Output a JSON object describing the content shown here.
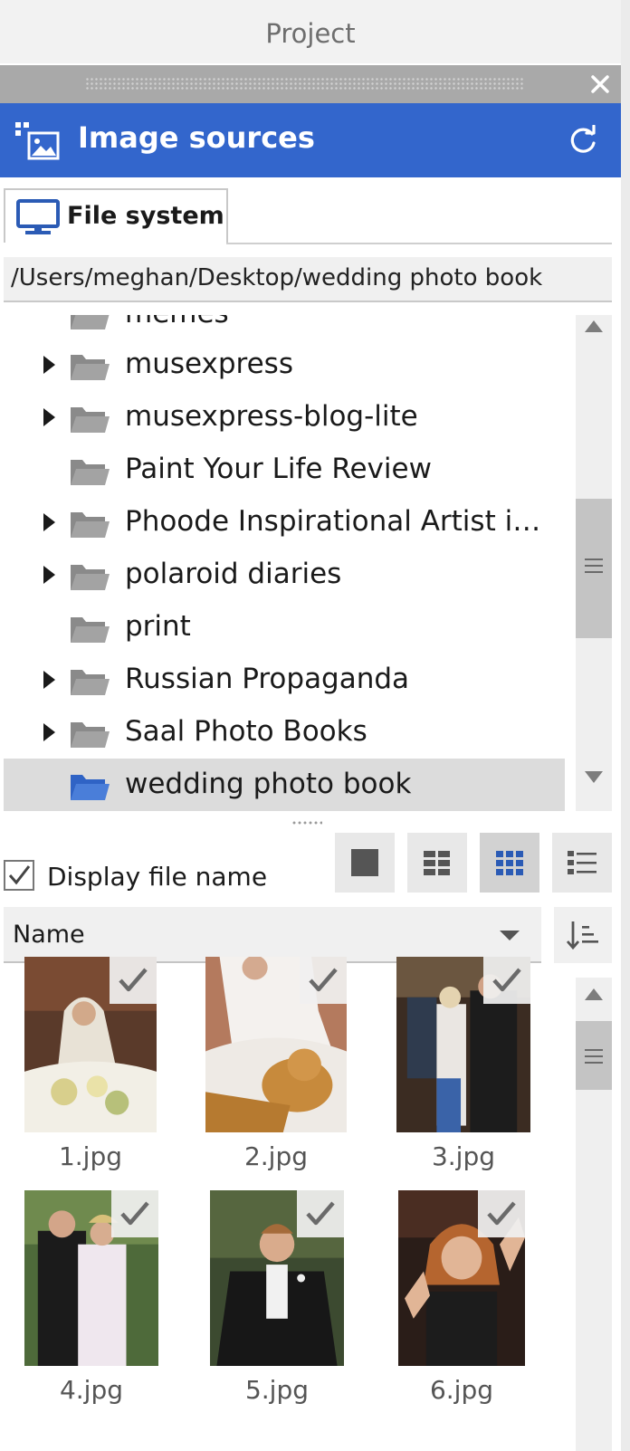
{
  "window": {
    "title": "Project"
  },
  "panel": {
    "title": "Image sources",
    "close_icon": "close-icon",
    "refresh_icon": "refresh-icon",
    "header_color": "#3366cc"
  },
  "tabs": [
    {
      "label": "File system",
      "icon": "monitor-icon",
      "active": true
    }
  ],
  "path": "/Users/meghan/Desktop/wedding photo book",
  "tree": {
    "items": [
      {
        "label": "memes",
        "expandable": false,
        "selected": false
      },
      {
        "label": "musexpress",
        "expandable": true,
        "selected": false
      },
      {
        "label": "musexpress-blog-lite",
        "expandable": true,
        "selected": false
      },
      {
        "label": "Paint Your Life Review",
        "expandable": false,
        "selected": false
      },
      {
        "label": "Phoode Inspirational Artist i…",
        "expandable": true,
        "selected": false
      },
      {
        "label": "polaroid diaries",
        "expandable": true,
        "selected": false
      },
      {
        "label": "print",
        "expandable": false,
        "selected": false
      },
      {
        "label": "Russian Propaganda",
        "expandable": true,
        "selected": false
      },
      {
        "label": "Saal Photo Books",
        "expandable": true,
        "selected": false
      },
      {
        "label": "wedding photo book",
        "expandable": false,
        "selected": true
      }
    ]
  },
  "view_options": {
    "display_file_name_label": "Display file name",
    "display_file_name_checked": true,
    "view_modes": [
      "single",
      "medium-grid",
      "small-grid",
      "list"
    ],
    "active_view_mode": "small-grid"
  },
  "sort": {
    "selected": "Name",
    "order_icon": "sort-ascending-icon"
  },
  "files": [
    {
      "name": "1.jpg",
      "checked": true
    },
    {
      "name": "2.jpg",
      "checked": true
    },
    {
      "name": "3.jpg",
      "checked": true
    },
    {
      "name": "4.jpg",
      "checked": true
    },
    {
      "name": "5.jpg",
      "checked": true
    },
    {
      "name": "6.jpg",
      "checked": true
    }
  ]
}
